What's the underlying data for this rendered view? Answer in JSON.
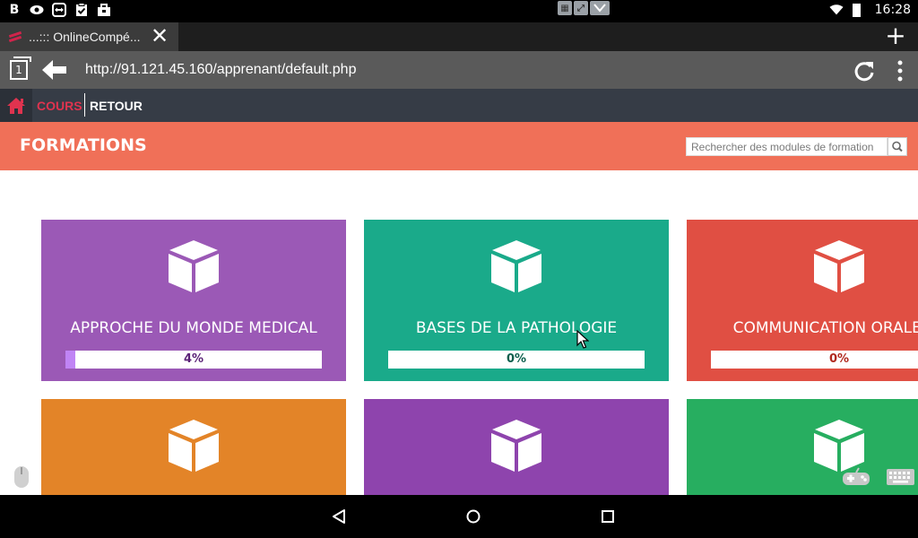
{
  "statusbar": {
    "time": "16:28",
    "left_icons": [
      "bold-b-icon",
      "eye-icon",
      "teamviewer-icon",
      "clipboard-check-icon",
      "briefcase-icon"
    ],
    "left_b_label": "B"
  },
  "browser": {
    "tab": {
      "title": "...::: OnlineCompé..."
    },
    "tabs_count": "1",
    "url": "http://91.121.45.160/apprenant/default.php"
  },
  "site": {
    "nav": {
      "cours": "COURS",
      "retour": "RETOUR"
    },
    "header": {
      "title": "FORMATIONS",
      "search_placeholder": "Rechercher des modules de formation"
    },
    "cards": [
      {
        "title": "APPROCHE DU MONDE MEDICAL",
        "progress": 4,
        "progress_label": "4%",
        "color": "#9b59b6",
        "progress_color": "#c084f5",
        "label_color": "#5b2377"
      },
      {
        "title": "BASES DE LA PATHOLOGIE",
        "progress": 0,
        "progress_label": "0%",
        "color": "#1aaa8a",
        "progress_color": "#1aaa8a",
        "label_color": "#0b5e4c"
      },
      {
        "title": "COMMUNICATION ORALE ET",
        "progress": 0,
        "progress_label": "0%",
        "color": "#e04f43",
        "progress_color": "#e04f43",
        "label_color": "#b0281d"
      },
      {
        "title": "",
        "color": "#e38428"
      },
      {
        "title": "",
        "color": "#8e44ad"
      },
      {
        "title": "",
        "color": "#27ae60"
      }
    ]
  },
  "colors": {
    "header_bg": "#f07058",
    "nav_bg": "#363c46",
    "nav_active": "#e0334f"
  }
}
